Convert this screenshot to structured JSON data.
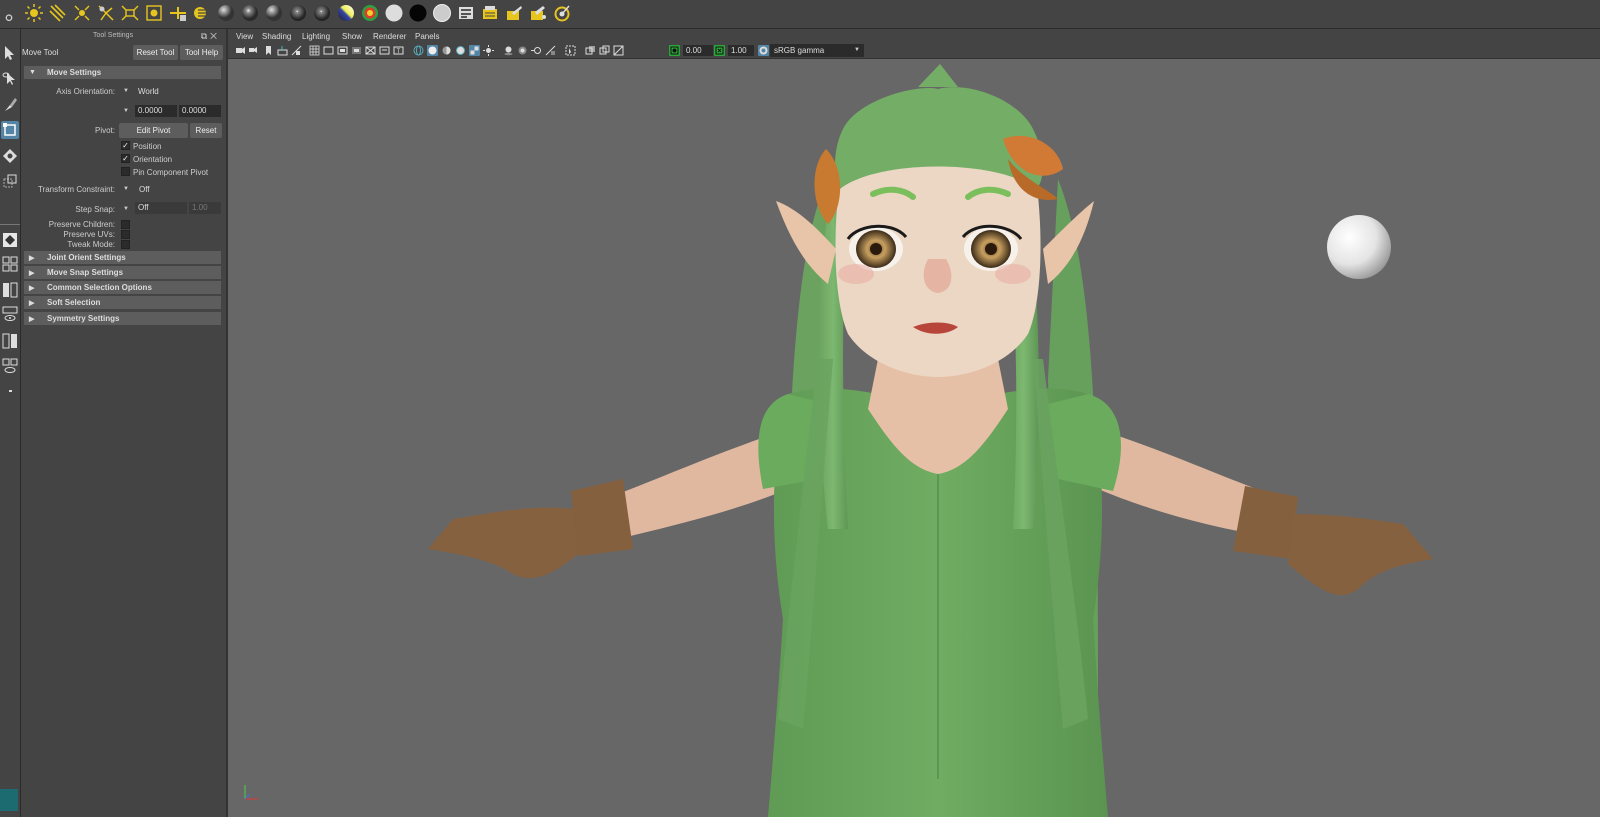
{
  "panel": {
    "title": "Tool Settings",
    "tool_name": "Move Tool",
    "reset_tool": "Reset Tool",
    "tool_help": "Tool Help",
    "move_settings": "Move Settings",
    "axis_orientation_label": "Axis Orientation:",
    "axis_orientation_value": "World",
    "axis_value_1": "0.0000",
    "axis_value_2": "0.0000",
    "pivot_label": "Pivot:",
    "edit_pivot": "Edit Pivot",
    "reset": "Reset",
    "position": "Position",
    "orientation": "Orientation",
    "pin_component_pivot": "Pin Component Pivot",
    "transform_constraint_label": "Transform Constraint:",
    "transform_constraint_value": "Off",
    "step_snap_label": "Step Snap:",
    "step_snap_value": "Off",
    "step_snap_amount": "1.00",
    "preserve_children": "Preserve Children:",
    "preserve_uvs": "Preserve UVs:",
    "tweak_mode": "Tweak Mode:",
    "sections": [
      "Joint Orient Settings",
      "Move Snap Settings",
      "Common Selection Options",
      "Soft Selection",
      "Symmetry Settings"
    ]
  },
  "viewport": {
    "menu": [
      "View",
      "Shading",
      "Lighting",
      "Show",
      "Renderer",
      "Panels"
    ],
    "exposure": "0.00",
    "gamma": "1.00",
    "color_space": "sRGB gamma"
  },
  "checkboxes": {
    "position": true,
    "orientation": true,
    "pin_component_pivot": false
  },
  "colors": {
    "accent": "#5285a6",
    "viewport_bg": "#676767",
    "panel_bg": "#444444"
  },
  "icons": {
    "shelf": [
      "sun-light-icon",
      "directional-light-icon",
      "point-light-icon",
      "spot-light-icon",
      "area-light-icon",
      "volume-light-icon",
      "light-editor-icon",
      "hypershade-icon",
      "shader-ball-icon",
      "shader-ball-icon",
      "shader-ball-icon",
      "shader-ball-icon",
      "shader-ball-icon",
      "ramp-shader-icon",
      "color-wheel-icon",
      "white-shader-icon",
      "black-shader-icon",
      "white-shader-icon",
      "render-settings-icon",
      "render-view-icon",
      "render-icon",
      "render-region-icon",
      "ipr-render-icon"
    ],
    "toolbox": [
      "select-arrow-icon",
      "lasso-icon",
      "paint-brush-icon",
      "move-icon",
      "rotate-icon",
      "scale-icon"
    ]
  }
}
